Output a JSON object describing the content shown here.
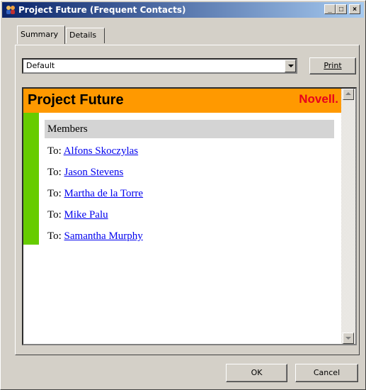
{
  "window": {
    "title": "Project Future (Frequent Contacts)",
    "controls": {
      "minimize": "_",
      "maximize": "□",
      "close": "×"
    }
  },
  "tabs": [
    {
      "label": "Summary",
      "active": true
    },
    {
      "label": "Details",
      "active": false
    }
  ],
  "view_select": {
    "value": "Default"
  },
  "print_button": {
    "label": "Print"
  },
  "summary": {
    "title": "Project Future",
    "brand": "Novell.",
    "section_header": "Members",
    "prefix": "To: ",
    "contacts": [
      "Alfons Skoczylas",
      "Jason Stevens",
      "Martha de la Torre",
      "Mike Palu",
      "Samantha Murphy"
    ],
    "colors": {
      "header_bg": "#ff9900",
      "strip": "#66cc00",
      "brand": "#e8001c",
      "link": "#0000ee"
    }
  },
  "buttons": {
    "ok": "OK",
    "cancel": "Cancel"
  },
  "icons": {
    "title": "contacts-group-icon"
  }
}
